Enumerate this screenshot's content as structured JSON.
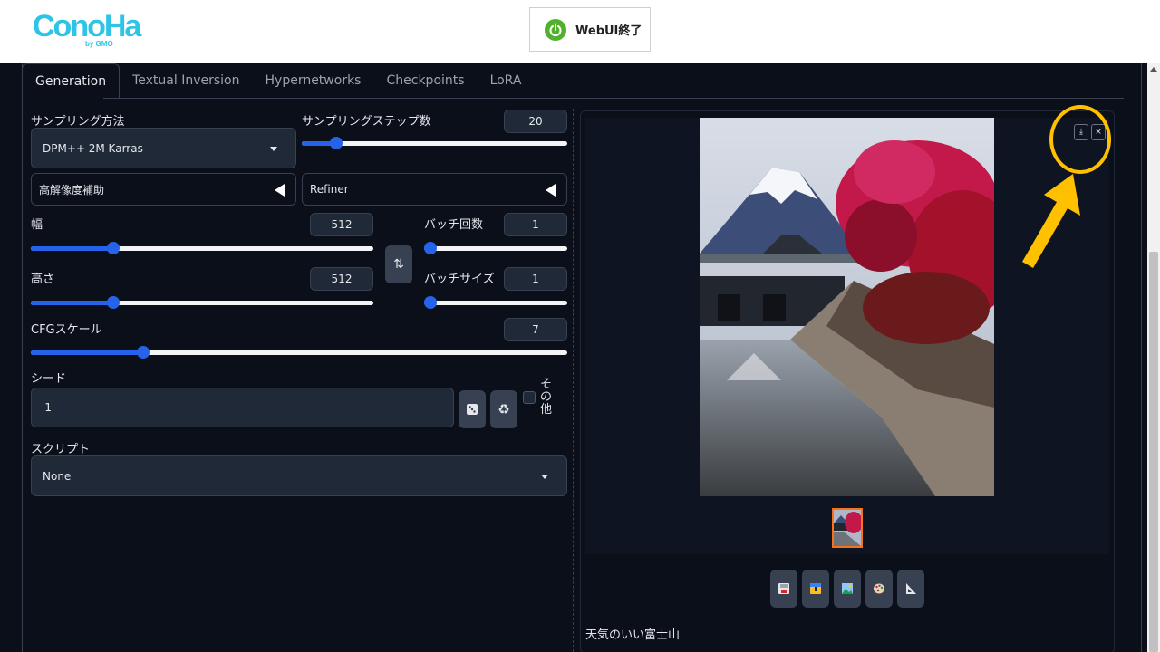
{
  "header": {
    "logo_text": "ConoHa",
    "logo_sub": "by GMO",
    "webui_button": "WebUI終了",
    "power_icon": "power-icon"
  },
  "tabs": [
    {
      "label": "Generation",
      "active": true
    },
    {
      "label": "Textual Inversion",
      "active": false
    },
    {
      "label": "Hypernetworks",
      "active": false
    },
    {
      "label": "Checkpoints",
      "active": false
    },
    {
      "label": "LoRA",
      "active": false
    }
  ],
  "settings": {
    "sampling_method_label": "サンプリング方法",
    "sampling_method_value": "DPM++ 2M Karras",
    "sampling_steps_label": "サンプリングステップ数",
    "sampling_steps_value": "20",
    "sampling_steps_fraction": 0.13,
    "hires_label": "高解像度補助",
    "refiner_label": "Refiner",
    "width_label": "幅",
    "width_value": "512",
    "width_fraction": 0.24,
    "height_label": "高さ",
    "height_value": "512",
    "height_fraction": 0.24,
    "batch_count_label": "バッチ回数",
    "batch_count_value": "1",
    "batch_count_fraction": 0.0,
    "batch_size_label": "バッチサイズ",
    "batch_size_value": "1",
    "batch_size_fraction": 0.0,
    "cfg_label": "CFGスケール",
    "cfg_value": "7",
    "cfg_fraction": 0.21,
    "seed_label": "シード",
    "seed_value": "-1",
    "extra_label": "その他",
    "script_label": "スクリプト",
    "script_value": "None",
    "swap_icon": "swap-icon",
    "dice_icon": "dice-icon",
    "recycle_icon": "recycle-icon"
  },
  "output": {
    "caption": "天気のいい富士山",
    "download_icon": "download-icon",
    "close_icon": "close-icon",
    "tool_icons": [
      "save-icon",
      "zip-icon",
      "image-icon",
      "palette-icon",
      "ruler-icon"
    ]
  },
  "colors": {
    "accent": "#2563eb",
    "background": "#0b0f19",
    "annotation": "#ffc000",
    "selected_thumb_border": "#f97316"
  }
}
